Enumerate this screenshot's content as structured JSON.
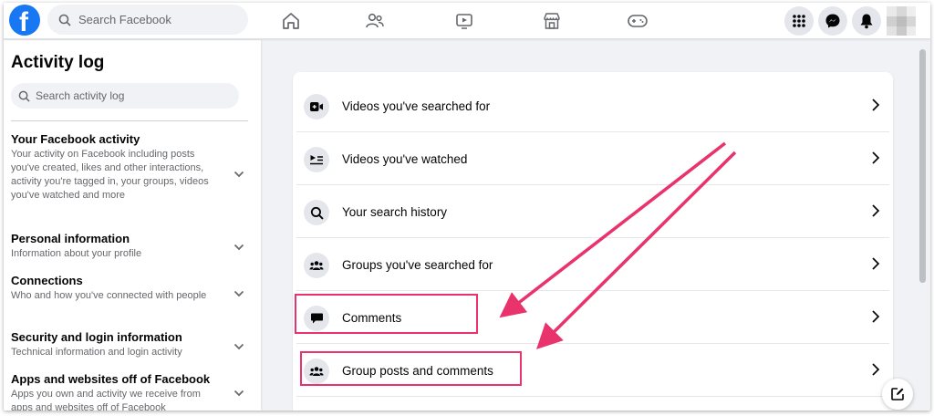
{
  "topbar": {
    "logo_letter": "f",
    "search_placeholder": "Search Facebook",
    "nav_icons": [
      "home-icon",
      "friends-icon",
      "watch-icon",
      "marketplace-icon",
      "gaming-icon"
    ],
    "right_icons": [
      "menu-grid-icon",
      "messenger-icon",
      "notifications-bell-icon"
    ]
  },
  "sidebar": {
    "title": "Activity log",
    "search_placeholder": "Search activity log",
    "sections": [
      {
        "title": "Your Facebook activity",
        "desc": "Your activity on Facebook including posts you've created, likes and other interactions, activity you're tagged in, your groups, videos you've watched and more"
      },
      {
        "title": "Personal information",
        "desc": "Information about your profile"
      },
      {
        "title": "Connections",
        "desc": "Who and how you've connected with people"
      },
      {
        "title": "Security and login information",
        "desc": "Technical information and login activity"
      },
      {
        "title": "Apps and websites off of Facebook",
        "desc": "Apps you own and activity we receive from apps and websites off of Facebook"
      }
    ]
  },
  "main": {
    "items": [
      {
        "label": "Videos you've searched for",
        "icon": "video-camera-icon"
      },
      {
        "label": "Videos you've watched",
        "icon": "video-list-icon"
      },
      {
        "label": "Your search history",
        "icon": "search-icon"
      },
      {
        "label": "Groups you've searched for",
        "icon": "groups-icon"
      },
      {
        "label": "Comments",
        "icon": "comment-icon"
      },
      {
        "label": "Group posts and comments",
        "icon": "groups-icon"
      }
    ]
  },
  "colors": {
    "brand": "#1877f2",
    "annotation": "#e8336c",
    "background": "#f0f2f5"
  }
}
